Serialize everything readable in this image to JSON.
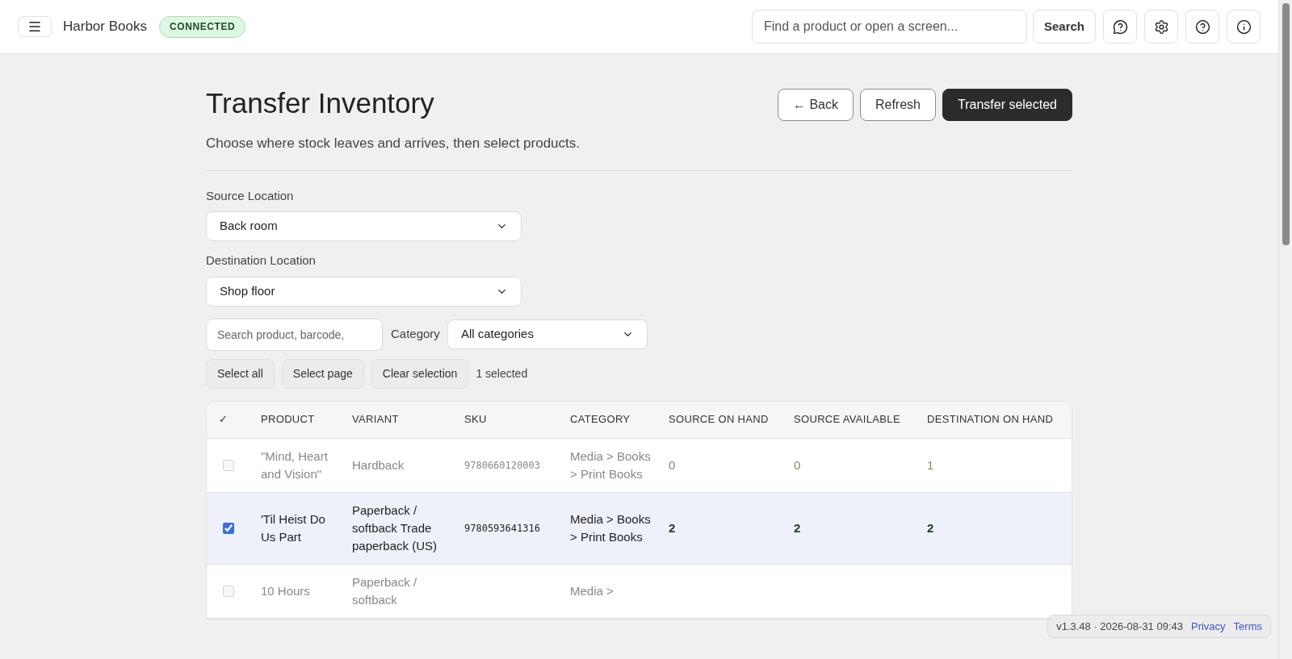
{
  "header": {
    "app_name": "Harbor Books",
    "status_badge": "CONNECTED",
    "search": {
      "placeholder": "Find a product or open a screen..."
    },
    "search_button": "Search"
  },
  "page": {
    "title": "Transfer Inventory",
    "subtitle": "Choose where stock leaves and arrives, then select products.",
    "actions": [
      {
        "label": "← Back",
        "kind": "secondary"
      },
      {
        "label": "Refresh",
        "kind": "secondary"
      },
      {
        "label": "Transfer selected",
        "kind": "primary"
      }
    ]
  },
  "source": {
    "label": "Source Location",
    "value": "Back room"
  },
  "destination": {
    "label": "Destination Location",
    "value": "Shop floor"
  },
  "filters": {
    "search": {
      "placeholder": "Search product, barcode,"
    },
    "category_label": "Category",
    "category_value": "All categories"
  },
  "selection": {
    "buttons": [
      "Select all",
      "Select page",
      "Clear selection"
    ],
    "count": "1 selected"
  },
  "table": {
    "columns": [
      "✓",
      "PRODUCT",
      "VARIANT",
      "SKU",
      "CATEGORY",
      "SOURCE ON HAND",
      "SOURCE AVAILABLE",
      "DESTINATION ON HAND"
    ],
    "rows": [
      {
        "checked": false,
        "disabled": true,
        "product": "\"Mind, Heart and Vision\"",
        "variant": "Hardback",
        "sku": "9780660120003",
        "category": "Media > Books > Print Books",
        "source_on_hand": "0",
        "source_available": "0",
        "destination_on_hand": "1"
      },
      {
        "checked": true,
        "disabled": false,
        "product": "'Til Heist Do Us Part",
        "variant": "Paperback / softback Trade paperback (US)",
        "sku": "9780593641316",
        "category": "Media > Books > Print Books",
        "source_on_hand": "2",
        "source_available": "2",
        "destination_on_hand": "2"
      },
      {
        "checked": false,
        "disabled": true,
        "product": "10 Hours",
        "variant": "Paperback / softback",
        "category": "Media >"
      }
    ]
  },
  "footer": {
    "version": "v1.3.48 · 2026-08-31 09:43",
    "links": [
      "Privacy",
      "Terms"
    ]
  }
}
